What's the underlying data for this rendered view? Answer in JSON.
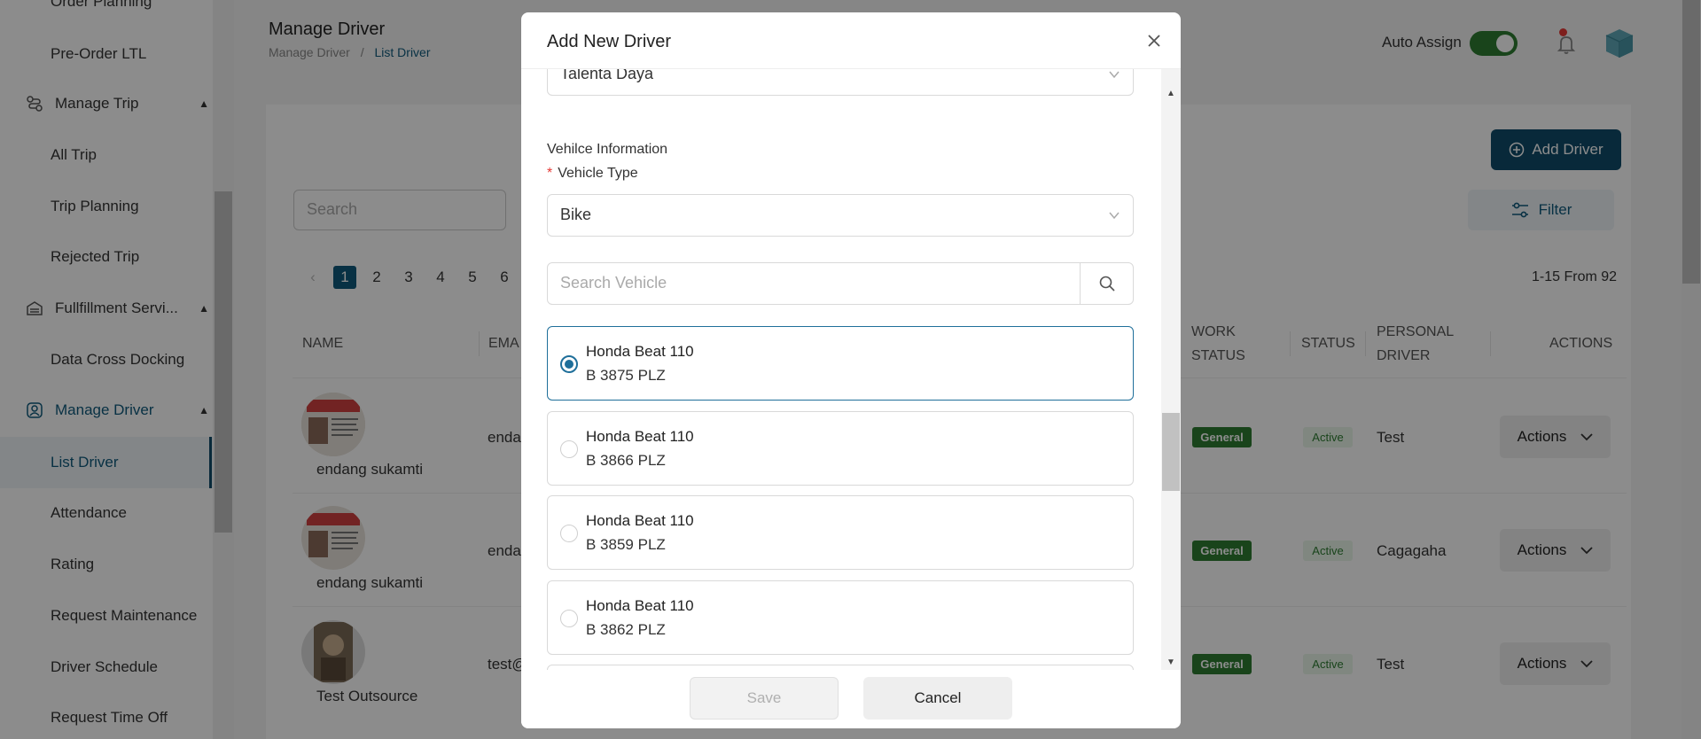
{
  "sidebar": {
    "items": [
      {
        "label": "Order Planning"
      },
      {
        "label": "Pre-Order LTL"
      },
      {
        "label": "Manage Trip"
      },
      {
        "label": "All Trip"
      },
      {
        "label": "Trip Planning"
      },
      {
        "label": "Rejected Trip"
      },
      {
        "label": "Fullfillment Servi..."
      },
      {
        "label": "Data Cross Docking"
      },
      {
        "label": "Manage Driver"
      },
      {
        "label": "List Driver"
      },
      {
        "label": "Attendance"
      },
      {
        "label": "Rating"
      },
      {
        "label": "Request Maintenance"
      },
      {
        "label": "Driver Schedule"
      },
      {
        "label": "Request Time Off"
      }
    ]
  },
  "header": {
    "title": "Manage Driver",
    "breadcrumb_root": "Manage Driver",
    "breadcrumb_sep": "/",
    "breadcrumb_current": "List Driver",
    "auto_assign_label": "Auto Assign"
  },
  "toolbar": {
    "add_driver_label": "Add Driver",
    "filter_label": "Filter",
    "search_placeholder": "Search"
  },
  "pagination": {
    "pages": [
      "1",
      "2",
      "3",
      "4",
      "5",
      "6"
    ],
    "range_text": "1-15 From 92"
  },
  "table": {
    "headers": {
      "name": "NAME",
      "email": "EMA",
      "work_status": "WORK STATUS",
      "status": "STATUS",
      "personal_driver": "PERSONAL DRIVER",
      "actions": "ACTIONS"
    },
    "rows": [
      {
        "name": "endang sukamti",
        "email": "enda",
        "work_status": "General",
        "status": "Active",
        "personal_driver": "Test",
        "actions": "Actions"
      },
      {
        "name": "endang sukamti",
        "email": "enda",
        "work_status": "General",
        "status": "Active",
        "personal_driver": "Cagagaha",
        "actions": "Actions"
      },
      {
        "name": "Test Outsource",
        "email": "test@",
        "work_status": "General",
        "status": "Active",
        "personal_driver": "Test",
        "actions": "Actions"
      }
    ]
  },
  "modal": {
    "title": "Add New Driver",
    "company_value": "Talenta Daya",
    "vehicle_section_label": "Vehilce Information",
    "required_mark": "*",
    "vehicle_type_label": "Vehicle Type",
    "vehicle_type_value": "Bike",
    "search_vehicle_placeholder": "Search Vehicle",
    "vehicles": [
      {
        "name": "Honda Beat 110",
        "plate": "B 3875 PLZ",
        "selected": true
      },
      {
        "name": "Honda Beat 110",
        "plate": "B 3866 PLZ",
        "selected": false
      },
      {
        "name": "Honda Beat 110",
        "plate": "B 3859 PLZ",
        "selected": false
      },
      {
        "name": "Honda Beat 110",
        "plate": "B 3862 PLZ",
        "selected": false
      }
    ],
    "save_label": "Save",
    "cancel_label": "Cancel"
  },
  "colors": {
    "brand": "#0f4c6a",
    "accent": "#1f6f9a",
    "success": "#2e7d32",
    "danger": "#e53935"
  }
}
